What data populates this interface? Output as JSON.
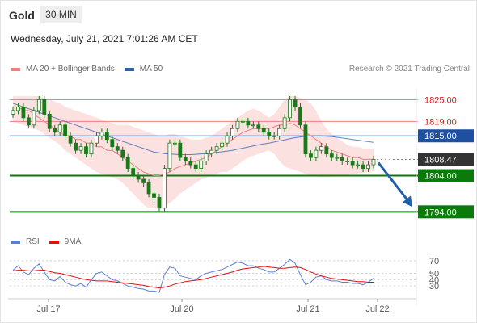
{
  "header": {
    "symbol": "Gold",
    "interval": "30 MIN",
    "datetime": "Wednesday, July 21, 2021 7:01:26 AM CET",
    "credit": "Research © 2021 Trading Central"
  },
  "legend": {
    "ma20_label": "MA 20 + Bollinger Bands",
    "ma20_color": "#f08080",
    "ma50_label": "MA 50",
    "ma50_color": "#2e5fa8",
    "rsi_label": "RSI",
    "rsi_color": "#5b7fd6",
    "ma9_label": "9MA",
    "ma9_color": "#e01010"
  },
  "colors": {
    "resistance": "#f08080",
    "pivot": "#1f4fa0",
    "support": "#0a7a0a",
    "last": "#333333",
    "candle": "#1a7a1a",
    "band_fill": "#fbd9d9",
    "arrow": "#1f5fa8"
  },
  "chart_data": [
    {
      "type": "candlestick",
      "title": "Gold 30 MIN",
      "x_tick_labels": [
        "Jul 17",
        "Jul 20",
        "Jul 21",
        "Jul 22"
      ],
      "ylim": [
        1790.5,
        1828
      ],
      "levels": [
        {
          "label": "1825.00",
          "value": 1825.0,
          "kind": "resistance"
        },
        {
          "label": "1819.00",
          "value": 1819.0,
          "kind": "resistance"
        },
        {
          "label": "1815.00",
          "value": 1815.0,
          "kind": "pivot"
        },
        {
          "label": "1808.47",
          "value": 1808.47,
          "kind": "last"
        },
        {
          "label": "1804.00",
          "value": 1804.0,
          "kind": "support"
        },
        {
          "label": "1794.00",
          "value": 1794.0,
          "kind": "support"
        }
      ],
      "forecast_arrow": {
        "from": 1808.47,
        "to": 1794.0
      },
      "price_close": [
        1822,
        1823,
        1820,
        1818,
        1822,
        1825,
        1821,
        1817,
        1816,
        1818,
        1815,
        1813,
        1811,
        1812,
        1810,
        1813,
        1815,
        1816,
        1814,
        1812,
        1811,
        1809,
        1806,
        1804,
        1803,
        1802,
        1799,
        1798,
        1795,
        1806,
        1813,
        1813,
        1809,
        1808,
        1807,
        1806,
        1808,
        1810,
        1811,
        1812,
        1813,
        1815,
        1817,
        1819,
        1819,
        1818,
        1818,
        1817,
        1816,
        1815,
        1815,
        1817,
        1820,
        1825,
        1823,
        1818,
        1810,
        1809,
        1811,
        1812,
        1810,
        1809,
        1809,
        1808,
        1808,
        1807,
        1807,
        1806,
        1807,
        1808.47
      ],
      "ma20": [
        1823,
        1823,
        1822,
        1822,
        1821,
        1820,
        1819,
        1818,
        1817,
        1816,
        1815,
        1815,
        1814,
        1814,
        1813,
        1813,
        1812,
        1812,
        1811,
        1811,
        1810,
        1809,
        1808,
        1807,
        1806,
        1805,
        1804.5,
        1804,
        1804,
        1804.5,
        1805,
        1806,
        1806.5,
        1807,
        1807.5,
        1808,
        1808.5,
        1809,
        1810,
        1811,
        1812,
        1813,
        1814,
        1815,
        1816,
        1816.5,
        1817,
        1817,
        1817,
        1817,
        1817.5,
        1818,
        1818,
        1818.5,
        1818,
        1817,
        1816,
        1815,
        1814,
        1813,
        1812,
        1811,
        1810.5,
        1810,
        1809.5,
        1809,
        1809,
        1808.5,
        1808.5,
        1808.5
      ],
      "ma50": [
        1824,
        1823.5,
        1823,
        1822.5,
        1822,
        1821.5,
        1821,
        1820.5,
        1820,
        1819.5,
        1819,
        1818.5,
        1818,
        1817.5,
        1817,
        1816.5,
        1816,
        1815.5,
        1815,
        1814.5,
        1814,
        1813.5,
        1813,
        1812.5,
        1812,
        1811.5,
        1811,
        1810.5,
        1810.3,
        1810.1,
        1810,
        1809.9,
        1809.8,
        1809.8,
        1809.8,
        1809.9,
        1810,
        1810.1,
        1810.2,
        1810.4,
        1810.6,
        1810.8,
        1811,
        1811.3,
        1811.6,
        1811.9,
        1812.2,
        1812.5,
        1812.8,
        1813,
        1813.3,
        1813.6,
        1813.9,
        1814.2,
        1814.5,
        1814.7,
        1814.9,
        1815,
        1815,
        1815,
        1814.9,
        1814.8,
        1814.6,
        1814.4,
        1814.2,
        1814,
        1813.8,
        1813.6,
        1813.4,
        1813.2
      ],
      "bb_upper": [
        1826,
        1826,
        1826,
        1826,
        1826,
        1826,
        1825.5,
        1825,
        1824.5,
        1824,
        1823,
        1822.5,
        1822,
        1821.5,
        1821,
        1820.5,
        1820,
        1819.5,
        1819,
        1818.5,
        1818,
        1818,
        1818,
        1817.5,
        1817,
        1816.5,
        1816,
        1815.5,
        1815,
        1815,
        1815.5,
        1815.5,
        1815,
        1814.5,
        1814,
        1814,
        1814,
        1814.5,
        1815,
        1816,
        1817,
        1818,
        1819,
        1820,
        1821,
        1822,
        1822.5,
        1822,
        1821,
        1820,
        1821,
        1823,
        1825,
        1826,
        1826,
        1825.5,
        1825,
        1824,
        1822,
        1819,
        1817,
        1815.5,
        1814.5,
        1813.5,
        1812.5,
        1812,
        1812,
        1811.5,
        1811.5,
        1811.5
      ],
      "bb_lower": [
        1819,
        1818.5,
        1818,
        1817.5,
        1817,
        1816.5,
        1815.5,
        1814.5,
        1813.5,
        1812.5,
        1811,
        1810,
        1809,
        1808,
        1807,
        1806,
        1805,
        1804.5,
        1804,
        1803.5,
        1803,
        1802,
        1800.5,
        1799,
        1797.5,
        1796,
        1795,
        1795,
        1795,
        1795.5,
        1796.5,
        1797.5,
        1799,
        1800,
        1801,
        1802,
        1803,
        1803.5,
        1804,
        1804.5,
        1805,
        1805,
        1806,
        1807,
        1808,
        1809,
        1809.5,
        1810,
        1810.5,
        1811,
        1810,
        1808,
        1806.5,
        1806,
        1805.5,
        1805,
        1804.5,
        1804,
        1803.8,
        1803.6,
        1803.6,
        1803.7,
        1803.8,
        1804,
        1804.2,
        1804.4,
        1804.6,
        1804.8,
        1805,
        1805.2
      ]
    },
    {
      "type": "line",
      "title": "RSI",
      "ylim": [
        20,
        80
      ],
      "y_tick_labels": [
        "70",
        "50",
        "40",
        "30"
      ],
      "series": [
        {
          "name": "RSI",
          "values": [
            55,
            62,
            52,
            48,
            58,
            65,
            52,
            40,
            38,
            45,
            36,
            32,
            30,
            34,
            28,
            40,
            50,
            52,
            46,
            40,
            38,
            34,
            30,
            28,
            26,
            25,
            22,
            22,
            20,
            48,
            60,
            58,
            46,
            44,
            42,
            40,
            46,
            50,
            52,
            54,
            56,
            60,
            64,
            68,
            66,
            62,
            62,
            58,
            56,
            52,
            52,
            58,
            64,
            72,
            66,
            48,
            32,
            36,
            44,
            46,
            40,
            38,
            38,
            36,
            36,
            34,
            34,
            32,
            36,
            42
          ]
        },
        {
          "name": "9MA",
          "values": [
            54,
            55,
            55,
            54,
            54,
            55,
            55,
            53,
            51,
            50,
            48,
            46,
            44,
            42,
            40,
            39,
            38,
            38,
            38,
            37,
            36,
            35,
            34,
            33,
            32,
            31,
            29,
            28,
            27,
            28,
            30,
            33,
            35,
            37,
            38,
            39,
            40,
            42,
            44,
            46,
            48,
            50,
            52,
            55,
            57,
            58,
            59,
            60,
            61,
            60,
            59,
            58,
            58,
            59,
            60,
            59,
            56,
            52,
            49,
            46,
            44,
            42,
            41,
            40,
            39,
            38,
            37,
            37,
            36,
            36
          ]
        }
      ]
    }
  ]
}
